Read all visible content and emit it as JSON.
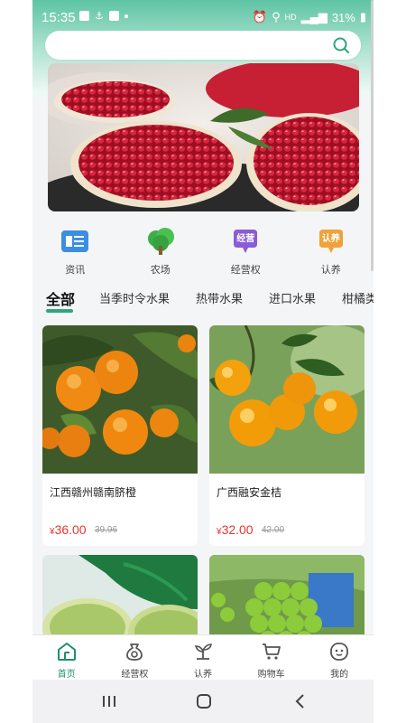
{
  "status_bar": {
    "time": "15:35",
    "battery": "31%",
    "network": "HD"
  },
  "search": {
    "placeholder": "",
    "icon": "search-icon"
  },
  "banner": {
    "subject": "pomegranate"
  },
  "categories": [
    {
      "label": "资讯",
      "icon": "news-icon"
    },
    {
      "label": "农场",
      "icon": "farm-tree-icon"
    },
    {
      "label": "经营权",
      "icon": "business-badge-icon",
      "badge": "经营"
    },
    {
      "label": "认养",
      "icon": "adopt-badge-icon",
      "badge": "认养"
    }
  ],
  "tabs": [
    {
      "label": "全部",
      "active": true
    },
    {
      "label": "当季时令水果"
    },
    {
      "label": "热带水果"
    },
    {
      "label": "进口水果"
    },
    {
      "label": "柑橘类"
    }
  ],
  "products": [
    {
      "name": "江西赣州赣南脐橙",
      "currency": "¥",
      "price": "36.00",
      "old_price": "39.96"
    },
    {
      "name": "广西融安金桔",
      "currency": "¥",
      "price": "32.00",
      "old_price": "42.00"
    },
    {
      "name": "",
      "currency": "",
      "price": "",
      "old_price": ""
    },
    {
      "name": "",
      "currency": "",
      "price": "",
      "old_price": ""
    }
  ],
  "bottom_nav": [
    {
      "label": "首页",
      "icon": "home-icon",
      "active": true
    },
    {
      "label": "经营权",
      "icon": "money-bag-icon"
    },
    {
      "label": "认养",
      "icon": "sprout-icon"
    },
    {
      "label": "购物车",
      "icon": "cart-icon"
    },
    {
      "label": "我的",
      "icon": "profile-icon"
    }
  ],
  "colors": {
    "accent": "#1f8f6b",
    "price": "#e0382f",
    "header_gradient": "#5ec4a3"
  }
}
